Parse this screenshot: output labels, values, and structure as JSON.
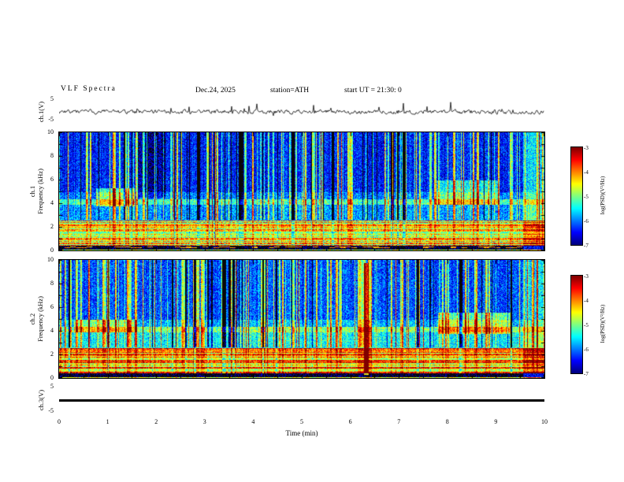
{
  "header": {
    "title": "VLF Spectra",
    "date": "Dec.24, 2025",
    "station": "station=ATH",
    "start_ut": "start UT =  21:30: 0"
  },
  "panels": {
    "ch1_wave": {
      "label": "ch.1(V)"
    },
    "ch1_spec": {
      "label_line1": "ch.1",
      "label_line2": "Frequency (kHz)"
    },
    "ch2_spec": {
      "label_line1": "ch.2",
      "label_line2": "Frequency (kHz)"
    },
    "ch3_wave": {
      "label": "ch.3(V)"
    }
  },
  "axes": {
    "time_label": "Time (min)",
    "time_ticks": [
      "0",
      "1",
      "2",
      "3",
      "4",
      "5",
      "6",
      "7",
      "8",
      "9",
      "10"
    ],
    "freq_ticks": [
      "10",
      "8",
      "6",
      "4",
      "2",
      "0"
    ],
    "volt_ticks": [
      "5",
      "-5"
    ]
  },
  "colorbar": {
    "label": "log(PSD)(V²/Hz)",
    "ticks": [
      "-3",
      "-4",
      "-5",
      "-6",
      "-7"
    ]
  },
  "chart_data": [
    {
      "type": "line",
      "title": "ch.1(V) waveform",
      "xlabel": "Time (min)",
      "ylabel": "ch.1(V)",
      "xlim": [
        0,
        10
      ],
      "ylim": [
        -5,
        5
      ],
      "summary": "Noisy trace centered near 0 V, amplitude about ±1 V, with intermittent positive spikes reaching roughly +3 to +4 V throughout the 10 minutes"
    },
    {
      "type": "heatmap",
      "title": "ch.1 VLF spectrogram",
      "xlabel": "Time (min)",
      "ylabel": "Frequency (kHz)",
      "zlabel": "log(PSD)(V²/Hz)",
      "xlim": [
        0,
        10
      ],
      "ylim": [
        0,
        10
      ],
      "zlim": [
        -7,
        -3
      ],
      "features": [
        "background power near -6.5 (dark blue) above 5 kHz with dense vertical sferic streaks (green/yellow) and clusters of very dark columns",
        "persistent cyan-green horizontal band near 4.0-4.4 kHz",
        "strong green/yellow horizontal harmonic striping (about -4.5 to -5) between 0.45 and 2.6 kHz",
        "near-black band about 0.1-0.45 kHz containing intermittent red/orange dashes",
        "enhanced green patch 3.8-5.3 kHz from about 0.8 to 1.5 min",
        "enhanced green patch 3.9-6 kHz from about 7.8 to 9.0 min",
        "bright full-band columns near 9.6-10 min"
      ]
    },
    {
      "type": "heatmap",
      "title": "ch.2 VLF spectrogram",
      "xlabel": "Time (min)",
      "ylabel": "Frequency (kHz)",
      "zlabel": "log(PSD)(V²/Hz)",
      "xlim": [
        0,
        10
      ],
      "ylim": [
        0,
        10
      ],
      "zlim": [
        -7,
        -3
      ],
      "features": [
        "overall brighter (greener) than ch.1, especially below 2.6 kHz where power is about -4.5",
        "vertical sferic streaks and dark column clusters above 5 kHz",
        "narrow red/orange full-band streak near 6.3 min",
        "persistent green band near 3.9-4.4 kHz",
        "near-black band about 0.1-0.45 kHz with intermittent red dashes",
        "enhanced green patch 3.8-5.6 kHz from about 7.8 to 9.3 min",
        "bright full-band columns near 9.6-10 min"
      ]
    },
    {
      "type": "line",
      "title": "ch.3(V) waveform",
      "xlabel": "Time (min)",
      "ylabel": "ch.3(V)",
      "xlim": [
        0,
        10
      ],
      "ylim": [
        -5,
        5
      ],
      "summary": "Flat thick line at 0 V for the entire interval (no signal)"
    }
  ],
  "render": {
    "zmin": -7,
    "zmax": -3,
    "wave1": {
      "seed": 7,
      "noise": 0.7,
      "spike_prob": 0.035,
      "spike_amp": 2.6
    },
    "wave3": {
      "value": 0
    },
    "spectrograms": [
      {
        "canvas": "ch1-spectrogram-canvas",
        "seed": 101,
        "streak_density": 0.2,
        "dark_density": 0.12,
        "bands": [
          {
            "f0": 5.0,
            "f1": 10.01,
            "level": -6.4
          },
          {
            "f0": 4.35,
            "f1": 5.0,
            "level": -6.0
          },
          {
            "f0": 3.9,
            "f1": 4.35,
            "level": -5.25
          },
          {
            "f0": 2.6,
            "f1": 3.9,
            "level": -5.9
          },
          {
            "f0": 0.45,
            "f1": 2.6,
            "level": -4.9
          },
          {
            "f0": 0.12,
            "f1": 0.45,
            "level": -7.3
          },
          {
            "f0": 0.0,
            "f1": 0.12,
            "level": -4.8
          }
        ],
        "harmonics": {
          "f0": 0.45,
          "f1": 2.6,
          "amp": 0.8
        },
        "black": {
          "f0": 0.12,
          "f1": 0.45
        },
        "patches": [
          {
            "t0": 0.75,
            "t1": 1.55,
            "f0": 3.8,
            "f1": 5.3,
            "delta": 1.1
          },
          {
            "t0": 1.6,
            "t1": 2.2,
            "f0": 4.5,
            "f1": 10.01,
            "delta": -0.5
          },
          {
            "t0": 7.75,
            "t1": 9.05,
            "f0": 3.9,
            "f1": 6.0,
            "delta": 0.9
          },
          {
            "t0": 9.55,
            "t1": 10.01,
            "f0": 0.0,
            "f1": 10.01,
            "delta": 0.7
          }
        ]
      },
      {
        "canvas": "ch2-spectrogram-canvas",
        "seed": 202,
        "streak_density": 0.2,
        "dark_density": 0.1,
        "bands": [
          {
            "f0": 5.0,
            "f1": 10.01,
            "level": -6.2
          },
          {
            "f0": 4.35,
            "f1": 5.0,
            "level": -5.8
          },
          {
            "f0": 3.9,
            "f1": 4.35,
            "level": -5.0
          },
          {
            "f0": 2.6,
            "f1": 3.9,
            "level": -5.5
          },
          {
            "f0": 0.45,
            "f1": 2.6,
            "level": -4.55
          },
          {
            "f0": 0.12,
            "f1": 0.45,
            "level": -7.3
          },
          {
            "f0": 0.0,
            "f1": 0.12,
            "level": -4.6
          }
        ],
        "harmonics": {
          "f0": 0.45,
          "f1": 2.6,
          "amp": 0.8
        },
        "black": {
          "f0": 0.12,
          "f1": 0.45
        },
        "patches": [
          {
            "t0": 0.3,
            "t1": 1.6,
            "f0": 3.9,
            "f1": 5.0,
            "delta": 0.8
          },
          {
            "t0": 6.27,
            "t1": 6.37,
            "f0": 0.3,
            "f1": 9.8,
            "delta": 2.6
          },
          {
            "t0": 7.8,
            "t1": 9.3,
            "f0": 3.8,
            "f1": 5.6,
            "delta": 1.1
          },
          {
            "t0": 9.55,
            "t1": 10.01,
            "f0": 0.0,
            "f1": 10.01,
            "delta": 0.7
          }
        ]
      }
    ]
  }
}
